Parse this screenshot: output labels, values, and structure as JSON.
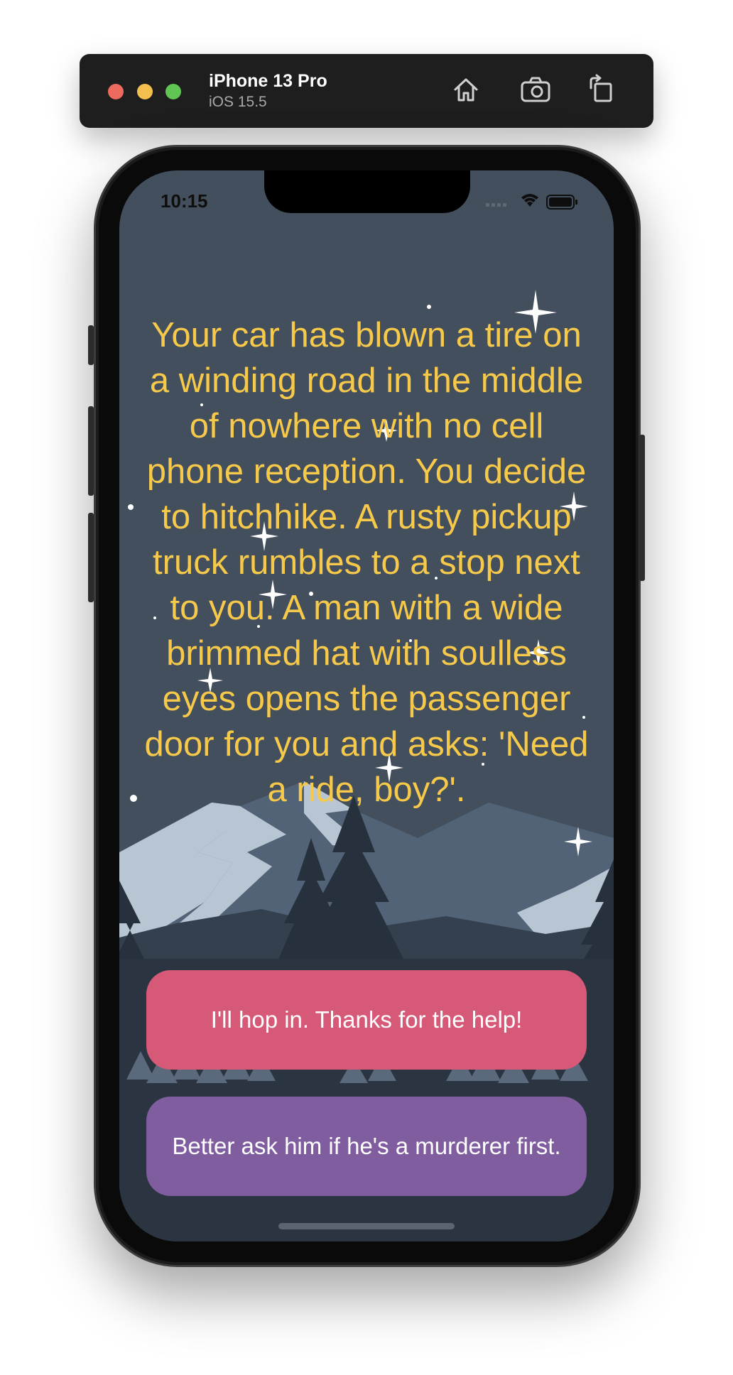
{
  "simulator": {
    "device_name": "iPhone 13 Pro",
    "os_version": "iOS 15.5",
    "toolbar_icons": [
      "home-icon",
      "screenshot-icon",
      "rotate-icon"
    ]
  },
  "status_bar": {
    "time": "10:15",
    "icons": [
      "signal-icon",
      "wifi-icon",
      "battery-icon"
    ]
  },
  "story": {
    "text": "Your car has blown a tire on a winding road in the middle of nowhere with no cell phone reception. You decide to hitchhike. A rusty pickup truck rumbles to a stop next to you. A man with a wide brimmed hat with soulless eyes opens the passenger door for you and asks: 'Need a ride, boy?'."
  },
  "choices": [
    {
      "label": "I'll hop in. Thanks for the help!",
      "color": "#d75978"
    },
    {
      "label": "Better ask him if he's a murderer first.",
      "color": "#7f5d9f"
    }
  ],
  "colors": {
    "text_accent": "#f6c94a",
    "sky": "#434f5d",
    "mountain_light": "#b8c6d4",
    "mountain_mid": "#526377",
    "trees_dark": "#27313d"
  }
}
